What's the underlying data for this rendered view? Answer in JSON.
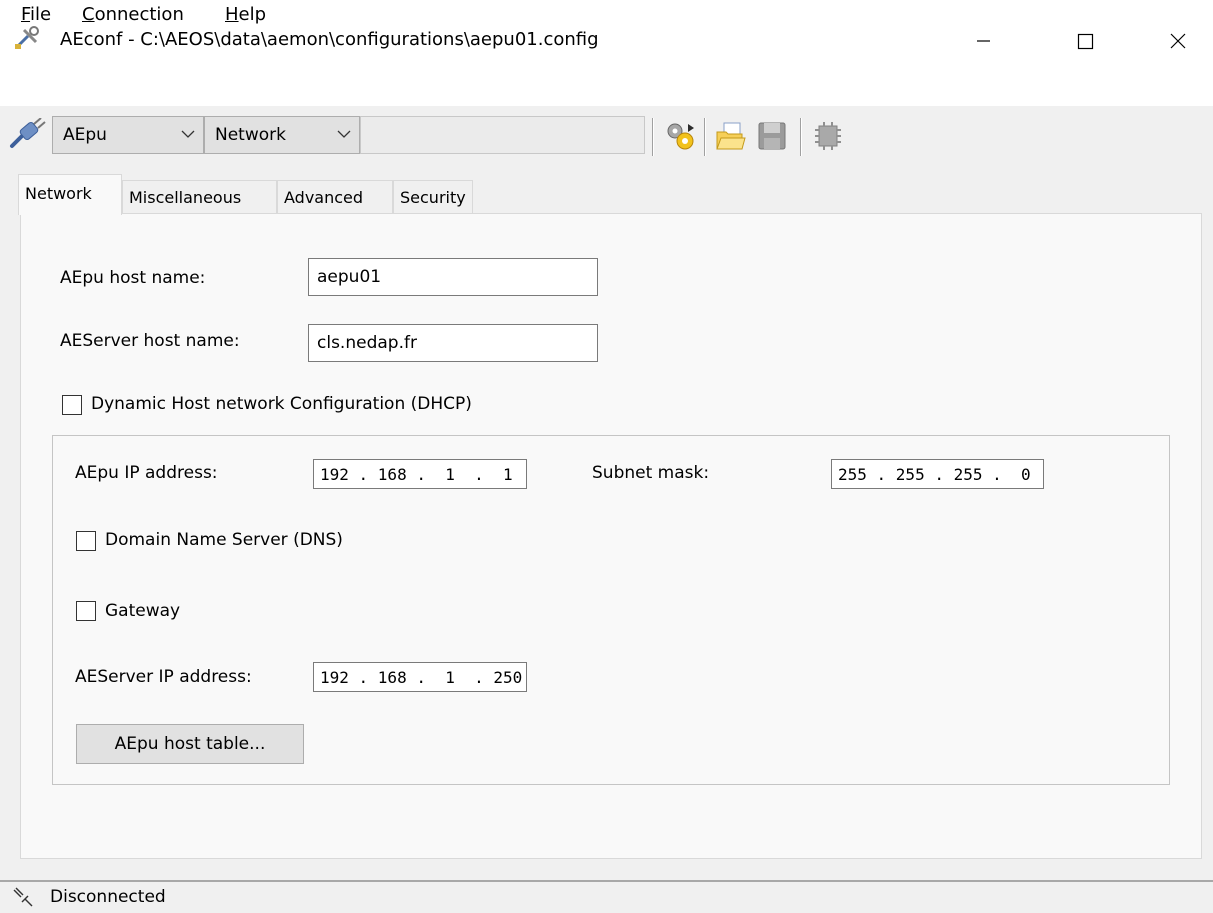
{
  "window": {
    "title": "AEconf - C:\\AEOS\\data\\aemon\\configurations\\aepu01.config",
    "app_icon": "tools-icon",
    "controls": {
      "minimize": "minimize-icon",
      "maximize": "maximize-icon",
      "close": "close-icon"
    }
  },
  "menu": {
    "file": {
      "underlined": "F",
      "rest": "ile"
    },
    "connection": {
      "underlined": "C",
      "rest": "onnection"
    },
    "help": {
      "underlined": "H",
      "rest": "elp"
    }
  },
  "toolbar": {
    "connect_icon": "plug-icon",
    "device_combo": {
      "value": "AEpu"
    },
    "section_combo": {
      "value": "Network"
    },
    "extra_combo": {
      "value": ""
    },
    "icons": [
      "gears-icon",
      "open-folder-icon",
      "save-disk-icon",
      "device-icon"
    ]
  },
  "tabs": [
    {
      "label": "Network",
      "active": true
    },
    {
      "label": "Miscellaneous",
      "active": false
    },
    {
      "label": "Advanced",
      "active": false
    },
    {
      "label": "Security",
      "active": false
    }
  ],
  "network": {
    "host_name_label": "AEpu host name:",
    "host_name_value": "aepu01",
    "server_host_label": "AEServer host name:",
    "server_host_value": "cls.nedap.fr",
    "dhcp_label": "Dynamic Host network Configuration (DHCP)",
    "dhcp_checked": false,
    "ip_label": "AEpu IP address:",
    "ip_value": "192 . 168 .  1  .  1",
    "subnet_label": "Subnet mask:",
    "subnet_value": "255 . 255 . 255 .  0",
    "dns_label": "Domain Name Server (DNS)",
    "dns_checked": false,
    "gateway_label": "Gateway",
    "gateway_checked": false,
    "server_ip_label": "AEServer IP address:",
    "server_ip_value": "192 . 168 .  1  . 250",
    "host_table_button": "AEpu host table..."
  },
  "status": {
    "icon": "disconnected-plug-icon",
    "text": "Disconnected"
  },
  "colors": {
    "window_bg": "#f0f0f0",
    "panel_bg": "#f9f9f9",
    "titlebar_bg": "#ffffff",
    "border": "#adadad"
  }
}
